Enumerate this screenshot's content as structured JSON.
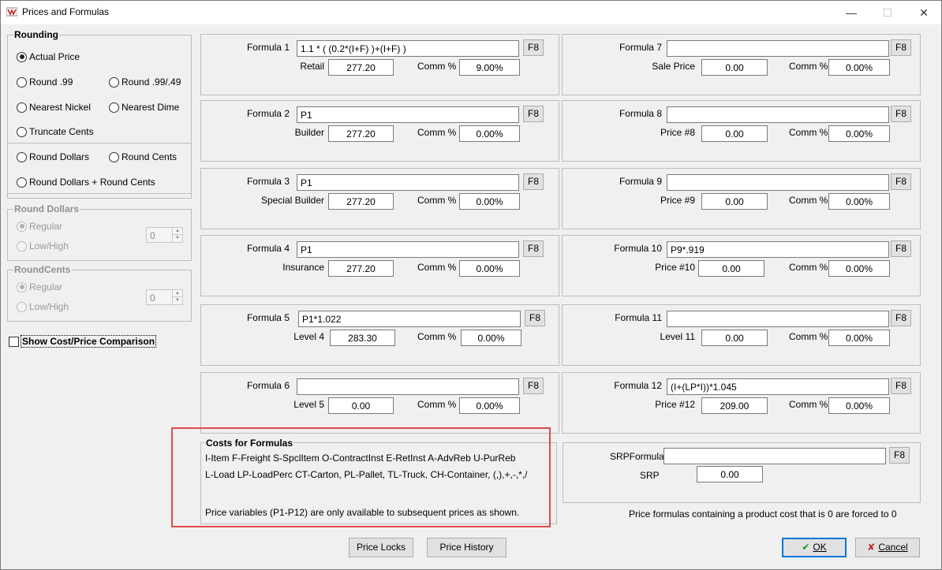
{
  "window": {
    "title": "Prices and Formulas",
    "minimize": "—",
    "maximize": "☐",
    "close": "✕"
  },
  "rounding": {
    "label": "Rounding",
    "options": {
      "actual": "Actual Price",
      "r99": "Round .99",
      "r9949": "Round .99/.49",
      "nickel": "Nearest Nickel",
      "dime": "Nearest Dime",
      "truncate": "Truncate Cents",
      "dollars": "Round Dollars",
      "cents": "Round Cents",
      "dollars_cents": "Round Dollars + Round Cents"
    },
    "selected": "Actual Price"
  },
  "round_dollars": {
    "label": "Round Dollars",
    "regular": "Regular",
    "lowhigh": "Low/High",
    "value": "0"
  },
  "round_cents": {
    "label": "RoundCents",
    "regular": "Regular",
    "lowhigh": "Low/High",
    "value": "0"
  },
  "show_comparison": "Show Cost/Price Comparison",
  "f8_label": "F8",
  "comm_label": "Comm %",
  "formulas": [
    {
      "label": "Formula 1",
      "formula": "1.1 * ( (0.2*(I+F) )+(I+F) )",
      "price_label": "Retail",
      "price": "277.20",
      "comm": "9.00%"
    },
    {
      "label": "Formula 2",
      "formula": "P1",
      "price_label": "Builder",
      "price": "277.20",
      "comm": "0.00%"
    },
    {
      "label": "Formula 3",
      "formula": "P1",
      "price_label": "Special Builder",
      "price": "277.20",
      "comm": "0.00%"
    },
    {
      "label": "Formula 4",
      "formula": "P1",
      "price_label": "Insurance",
      "price": "277.20",
      "comm": "0.00%"
    },
    {
      "label": "Formula 5",
      "formula": "P1*1.022",
      "price_label": "Level 4",
      "price": "283.30",
      "comm": "0.00%"
    },
    {
      "label": "Formula 6",
      "formula": "",
      "price_label": "Level 5",
      "price": "0.00",
      "comm": "0.00%"
    },
    {
      "label": "Formula 7",
      "formula": "",
      "price_label": "Sale Price",
      "price": "0.00",
      "comm": "0.00%"
    },
    {
      "label": "Formula 8",
      "formula": "",
      "price_label": "Price #8",
      "price": "0.00",
      "comm": "0.00%"
    },
    {
      "label": "Formula 9",
      "formula": "",
      "price_label": "Price #9",
      "price": "0.00",
      "comm": "0.00%"
    },
    {
      "label": "Formula 10",
      "formula": "P9*.919",
      "price_label": "Price #10",
      "price": "0.00",
      "comm": "0.00%"
    },
    {
      "label": "Formula 11",
      "formula": "",
      "price_label": "Level 11",
      "price": "0.00",
      "comm": "0.00%"
    },
    {
      "label": "Formula 12",
      "formula": "(I+(LP*I))*1.045",
      "price_label": "Price #12",
      "price": "209.00",
      "comm": "0.00%"
    }
  ],
  "costs": {
    "label": "Costs for Formulas",
    "line1": "I-Item  F-Freight  S-SpclItem  O-ContractInst E-RetInst  A-AdvReb  U-PurReb",
    "line2": "L-Load  LP-LoadPerc CT-Carton, PL-Pallet, TL-Truck,  CH-Container, (,),+,-,*,/",
    "line3": "Price variables (P1-P12) are only available to subsequent prices as shown."
  },
  "srp": {
    "formula_label": "SRPFormula",
    "formula": "",
    "srp_label": "SRP",
    "value": "0.00"
  },
  "zero_note": "Price formulas containing a product cost that is 0 are forced to 0",
  "buttons": {
    "price_locks": "Price Locks",
    "price_history": "Price History",
    "ok_icon": "✔",
    "ok": "OK",
    "cancel_icon": "✘",
    "cancel": "Cancel"
  },
  "colors": {
    "highlight": "#e04a4a",
    "default_button_border": "#0078d7"
  }
}
